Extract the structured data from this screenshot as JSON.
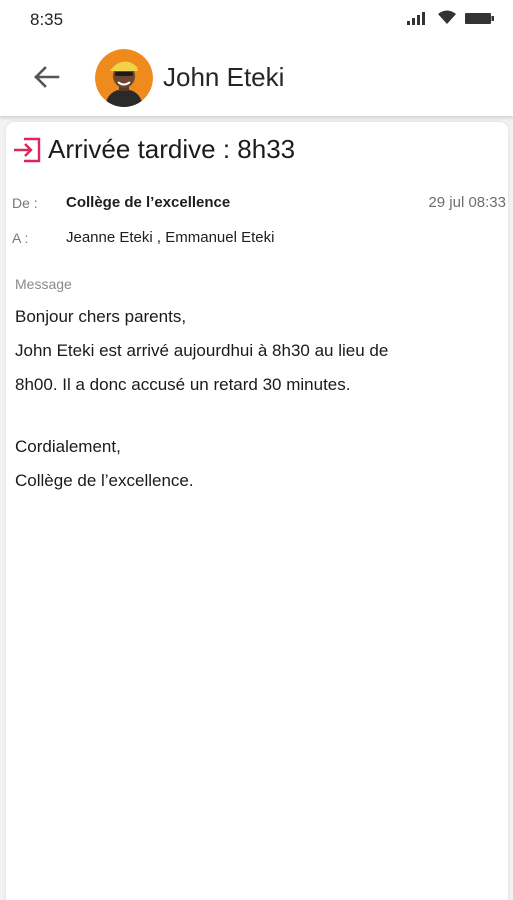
{
  "status_bar": {
    "time": "8:35"
  },
  "header": {
    "back_icon": "arrow-left-icon",
    "contact_name": "John Eteki"
  },
  "message": {
    "subject": "Arrivée tardive : 8h33",
    "subject_icon": "login-icon",
    "accent_color": "#e0245e",
    "from_label": "De :",
    "from_value": "Collège de l’excellence",
    "date": "29 jul 08:33",
    "to_label": "A :",
    "to_value": "Jeanne Eteki , Emmanuel Eteki",
    "body_label": "Message",
    "body_lines": [
      "Bonjour chers parents,",
      "John Eteki est arrivé aujourdhui à 8h30 au lieu de",
      "8h00. Il a donc accusé un retard 30 minutes.",
      "Cordialement,",
      "Collège de l’excellence."
    ]
  }
}
